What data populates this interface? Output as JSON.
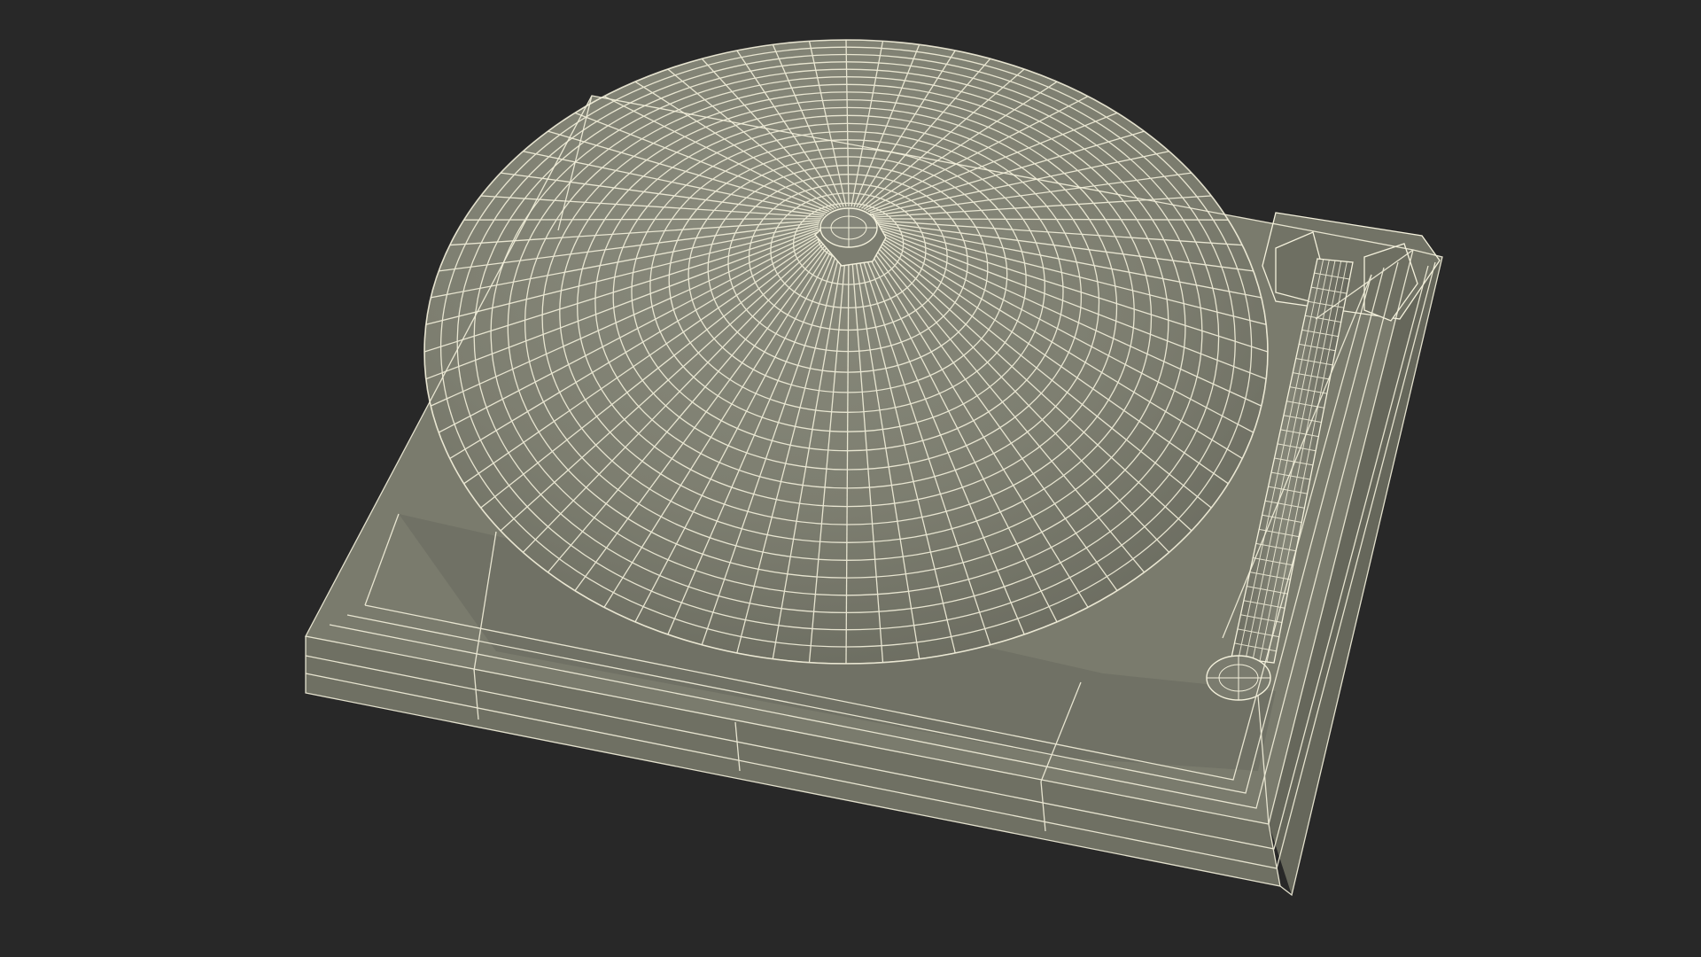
{
  "scene": {
    "subject": "turntable-wireframe-render",
    "colors": {
      "background": "#282828",
      "surface": "#7b7c6e",
      "surface_dark": "#5e5f54",
      "surface_light": "#8a8b7d",
      "wire": "#f4f1dc"
    }
  }
}
